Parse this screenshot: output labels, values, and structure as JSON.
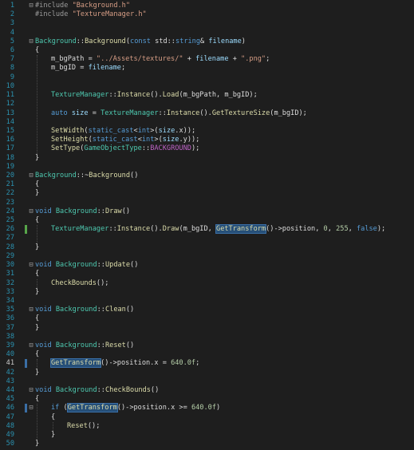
{
  "editor": {
    "lines": [
      {
        "n": "1",
        "fold": "⊟",
        "indent": 0,
        "tokens": [
          [
            "pp",
            "#include "
          ],
          [
            "str",
            "\"Background.h\""
          ]
        ]
      },
      {
        "n": "2",
        "indent": 0,
        "tokens": [
          [
            "pp",
            "#include "
          ],
          [
            "str",
            "\"TextureManager.h\""
          ]
        ]
      },
      {
        "n": "3",
        "indent": 0,
        "tokens": []
      },
      {
        "n": "4",
        "indent": 0,
        "tokens": []
      },
      {
        "n": "5",
        "fold": "⊟",
        "indent": 0,
        "tokens": [
          [
            "cls",
            "Background"
          ],
          [
            "t",
            "::"
          ],
          [
            "fn",
            "Background"
          ],
          [
            "t",
            "("
          ],
          [
            "kw",
            "const "
          ],
          [
            "t",
            "std::"
          ],
          [
            "kw",
            "string"
          ],
          [
            "t",
            "& "
          ],
          [
            "var",
            "filename"
          ],
          [
            "t",
            ")"
          ]
        ]
      },
      {
        "n": "6",
        "indent": 0,
        "tokens": [
          [
            "t",
            "{"
          ]
        ]
      },
      {
        "n": "7",
        "indent": 1,
        "tokens": [
          [
            "t",
            "m_bgPath = "
          ],
          [
            "str",
            "\"../Assets/textures/\""
          ],
          [
            "t",
            " + "
          ],
          [
            "var",
            "filename"
          ],
          [
            "t",
            " + "
          ],
          [
            "str",
            "\".png\""
          ],
          [
            "t",
            ";"
          ]
        ]
      },
      {
        "n": "8",
        "indent": 1,
        "tokens": [
          [
            "t",
            "m_bgID = "
          ],
          [
            "var",
            "filename"
          ],
          [
            "t",
            ";"
          ]
        ]
      },
      {
        "n": "9",
        "indent": 0,
        "tokens": []
      },
      {
        "n": "10",
        "indent": 0,
        "tokens": []
      },
      {
        "n": "11",
        "indent": 1,
        "tokens": [
          [
            "cls",
            "TextureManager"
          ],
          [
            "t",
            "::"
          ],
          [
            "fn",
            "Instance"
          ],
          [
            "t",
            "()."
          ],
          [
            "fn",
            "Load"
          ],
          [
            "t",
            "(m_bgPath, m_bgID);"
          ]
        ]
      },
      {
        "n": "12",
        "indent": 0,
        "tokens": []
      },
      {
        "n": "13",
        "indent": 1,
        "tokens": [
          [
            "kw",
            "auto "
          ],
          [
            "var",
            "size"
          ],
          [
            "t",
            " = "
          ],
          [
            "cls",
            "TextureManager"
          ],
          [
            "t",
            "::"
          ],
          [
            "fn",
            "Instance"
          ],
          [
            "t",
            "()."
          ],
          [
            "fn",
            "GetTextureSize"
          ],
          [
            "t",
            "(m_bgID);"
          ]
        ]
      },
      {
        "n": "14",
        "indent": 0,
        "tokens": []
      },
      {
        "n": "15",
        "indent": 1,
        "tokens": [
          [
            "fn",
            "SetWidth"
          ],
          [
            "t",
            "("
          ],
          [
            "kw",
            "static_cast"
          ],
          [
            "t",
            "<"
          ],
          [
            "kw",
            "int"
          ],
          [
            "t",
            ">("
          ],
          [
            "var",
            "size"
          ],
          [
            "t",
            ".x));"
          ]
        ]
      },
      {
        "n": "16",
        "indent": 1,
        "tokens": [
          [
            "fn",
            "SetHeight"
          ],
          [
            "t",
            "("
          ],
          [
            "kw",
            "static_cast"
          ],
          [
            "t",
            "<"
          ],
          [
            "kw",
            "int"
          ],
          [
            "t",
            ">("
          ],
          [
            "var",
            "size"
          ],
          [
            "t",
            ".y));"
          ]
        ]
      },
      {
        "n": "17",
        "indent": 1,
        "tokens": [
          [
            "fn",
            "SetType"
          ],
          [
            "t",
            "("
          ],
          [
            "cls",
            "GameObjectType"
          ],
          [
            "t",
            "::"
          ],
          [
            "mac",
            "BACKGROUND"
          ],
          [
            "t",
            ");"
          ]
        ]
      },
      {
        "n": "18",
        "indent": 0,
        "tokens": [
          [
            "t",
            "}"
          ]
        ]
      },
      {
        "n": "19",
        "indent": 0,
        "tokens": []
      },
      {
        "n": "20",
        "fold": "⊟",
        "indent": 0,
        "tokens": [
          [
            "cls",
            "Background"
          ],
          [
            "t",
            "::~"
          ],
          [
            "fn",
            "Background"
          ],
          [
            "t",
            "()"
          ]
        ]
      },
      {
        "n": "21",
        "indent": 0,
        "tokens": [
          [
            "t",
            "{"
          ]
        ]
      },
      {
        "n": "22",
        "indent": 0,
        "tokens": [
          [
            "t",
            "}"
          ]
        ]
      },
      {
        "n": "23",
        "indent": 0,
        "tokens": []
      },
      {
        "n": "24",
        "fold": "⊟",
        "indent": 0,
        "tokens": [
          [
            "kw",
            "void "
          ],
          [
            "cls",
            "Background"
          ],
          [
            "t",
            "::"
          ],
          [
            "fn",
            "Draw"
          ],
          [
            "t",
            "()"
          ]
        ]
      },
      {
        "n": "25",
        "indent": 0,
        "tokens": [
          [
            "t",
            "{"
          ]
        ]
      },
      {
        "n": "26",
        "indent": 1,
        "gutter": "#57a64a",
        "tokens": [
          [
            "cls",
            "TextureManager"
          ],
          [
            "t",
            "::"
          ],
          [
            "fn",
            "Instance"
          ],
          [
            "t",
            "()."
          ],
          [
            "fn",
            "Draw"
          ],
          [
            "t",
            "(m_bgID, "
          ],
          [
            "fnhl",
            "GetTransform"
          ],
          [
            "t",
            "()->position, "
          ],
          [
            "num",
            "0"
          ],
          [
            "t",
            ", "
          ],
          [
            "num",
            "255"
          ],
          [
            "t",
            ", "
          ],
          [
            "kw",
            "false"
          ],
          [
            "t",
            ");"
          ]
        ]
      },
      {
        "n": "27",
        "indent": 0,
        "tokens": []
      },
      {
        "n": "28",
        "indent": 0,
        "tokens": [
          [
            "t",
            "}"
          ]
        ]
      },
      {
        "n": "29",
        "indent": 0,
        "tokens": []
      },
      {
        "n": "30",
        "fold": "⊟",
        "indent": 0,
        "tokens": [
          [
            "kw",
            "void "
          ],
          [
            "cls",
            "Background"
          ],
          [
            "t",
            "::"
          ],
          [
            "fn",
            "Update"
          ],
          [
            "t",
            "()"
          ]
        ]
      },
      {
        "n": "31",
        "indent": 0,
        "tokens": [
          [
            "t",
            "{"
          ]
        ]
      },
      {
        "n": "32",
        "indent": 1,
        "tokens": [
          [
            "fn",
            "CheckBounds"
          ],
          [
            "t",
            "();"
          ]
        ]
      },
      {
        "n": "33",
        "indent": 0,
        "tokens": [
          [
            "t",
            "}"
          ]
        ]
      },
      {
        "n": "34",
        "indent": 0,
        "tokens": []
      },
      {
        "n": "35",
        "fold": "⊟",
        "indent": 0,
        "tokens": [
          [
            "kw",
            "void "
          ],
          [
            "cls",
            "Background"
          ],
          [
            "t",
            "::"
          ],
          [
            "fn",
            "Clean"
          ],
          [
            "t",
            "()"
          ]
        ]
      },
      {
        "n": "36",
        "indent": 0,
        "tokens": [
          [
            "t",
            "{"
          ]
        ]
      },
      {
        "n": "37",
        "indent": 0,
        "tokens": [
          [
            "t",
            "}"
          ]
        ]
      },
      {
        "n": "38",
        "indent": 0,
        "tokens": []
      },
      {
        "n": "39",
        "fold": "⊟",
        "indent": 0,
        "tokens": [
          [
            "kw",
            "void "
          ],
          [
            "cls",
            "Background"
          ],
          [
            "t",
            "::"
          ],
          [
            "fn",
            "Reset"
          ],
          [
            "t",
            "()"
          ]
        ]
      },
      {
        "n": "40",
        "indent": 0,
        "tokens": [
          [
            "t",
            "{"
          ]
        ]
      },
      {
        "n": "41",
        "indent": 1,
        "gutter": "#3a6ea5",
        "tokens": [
          [
            "fnhl",
            "GetTransform"
          ],
          [
            "t",
            "()->position.x = "
          ],
          [
            "num",
            "640.0f"
          ],
          [
            "t",
            ";"
          ]
        ]
      },
      {
        "n": "42",
        "indent": 0,
        "tokens": [
          [
            "t",
            "}"
          ]
        ]
      },
      {
        "n": "43",
        "indent": 0,
        "tokens": []
      },
      {
        "n": "44",
        "fold": "⊟",
        "indent": 0,
        "tokens": [
          [
            "kw",
            "void "
          ],
          [
            "cls",
            "Background"
          ],
          [
            "t",
            "::"
          ],
          [
            "fn",
            "CheckBounds"
          ],
          [
            "t",
            "()"
          ]
        ]
      },
      {
        "n": "45",
        "indent": 0,
        "tokens": [
          [
            "t",
            "{"
          ]
        ]
      },
      {
        "n": "46",
        "fold": "⊟",
        "indent": 1,
        "gutter": "#3a6ea5",
        "tokens": [
          [
            "kw",
            "if "
          ],
          [
            "t",
            "("
          ],
          [
            "fnhl",
            "GetTransform"
          ],
          [
            "t",
            "()->position.x >= "
          ],
          [
            "num",
            "640.0f"
          ],
          [
            "t",
            ")"
          ]
        ]
      },
      {
        "n": "47",
        "indent": 1,
        "tokens": [
          [
            "t",
            "{"
          ]
        ]
      },
      {
        "n": "48",
        "indent": 2,
        "tokens": [
          [
            "fn",
            "Reset"
          ],
          [
            "t",
            "();"
          ]
        ]
      },
      {
        "n": "49",
        "indent": 1,
        "tokens": [
          [
            "t",
            "}"
          ]
        ]
      },
      {
        "n": "50",
        "indent": 0,
        "tokens": [
          [
            "t",
            "}"
          ]
        ]
      }
    ]
  }
}
